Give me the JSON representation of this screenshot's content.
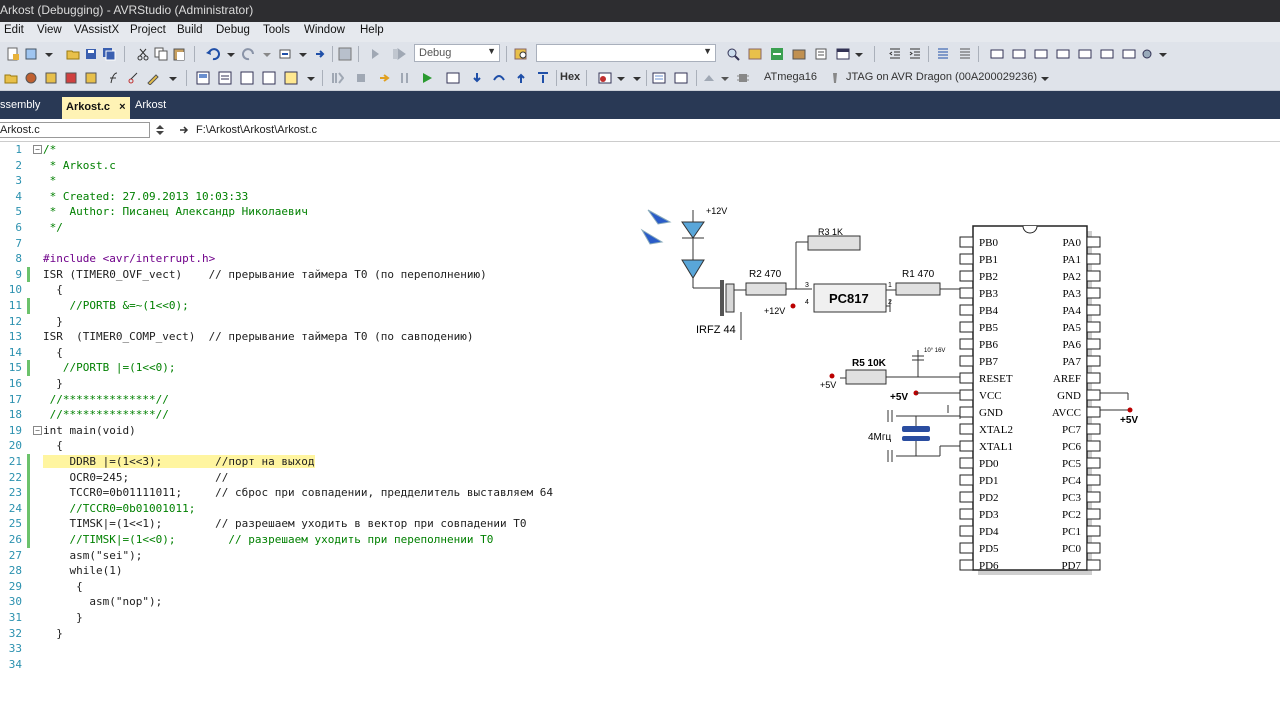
{
  "window": {
    "title": "Arkost (Debugging) - AVRStudio (Administrator)"
  },
  "menu": [
    "Edit",
    "View",
    "VAssistX",
    "Project",
    "Build",
    "Debug",
    "Tools",
    "Window",
    "Help"
  ],
  "toolbar": {
    "config_value": "Debug",
    "hex_label": "Hex",
    "device": "ATmega16",
    "tool": "JTAG on AVR Dragon (00A200029236)"
  },
  "tabs": [
    {
      "label": "ssembly"
    },
    {
      "label": "Arkost.c",
      "close": "×"
    },
    {
      "label": "Arkost"
    }
  ],
  "nav": {
    "file": "Arkost.c",
    "path": "F:\\Arkost\\Arkost\\Arkost.c"
  },
  "code_lines": [
    {
      "n": "1",
      "text": "/*"
    },
    {
      "n": "2",
      "text": " * Arkost.c"
    },
    {
      "n": "3",
      "text": " *"
    },
    {
      "n": "4",
      "text": " * Created: 27.09.2013 10:03:33"
    },
    {
      "n": "5",
      "text": " *  Author: Писанец Александр Николаевич"
    },
    {
      "n": "6",
      "text": " */"
    },
    {
      "n": "7",
      "text": ""
    },
    {
      "n": "8",
      "text": "#include <avr/interrupt.h>"
    },
    {
      "n": "9",
      "text": "ISR (TIMER0_OVF_vect)    // прерывание таймера T0 (по переполнению)"
    },
    {
      "n": "10",
      "text": "  {"
    },
    {
      "n": "11",
      "text": "    //PORTB &=~(1<<0);"
    },
    {
      "n": "12",
      "text": "  }"
    },
    {
      "n": "13",
      "text": "ISR  (TIMER0_COMP_vect)  // прерывание таймера T0 (по савподению)"
    },
    {
      "n": "14",
      "text": "  {"
    },
    {
      "n": "15",
      "text": "   //PORTB |=(1<<0);"
    },
    {
      "n": "16",
      "text": "  }"
    },
    {
      "n": "17",
      "text": " //**************//"
    },
    {
      "n": "18",
      "text": " //**************//"
    },
    {
      "n": "19",
      "text": "int main(void)"
    },
    {
      "n": "20",
      "text": "  {"
    },
    {
      "n": "21",
      "text": "    DDRB |=(1<<3);        //порт на выход"
    },
    {
      "n": "22",
      "text": "    OCR0=245;             //"
    },
    {
      "n": "23",
      "text": "    TCCR0=0b01111011;     // сброс при совпадении, предделитель выставляем 64"
    },
    {
      "n": "24",
      "text": "    //TCCR0=0b01001011;"
    },
    {
      "n": "25",
      "text": "    TIMSK|=(1<<1);        // разрешаем уходить в вектор при совпадении T0"
    },
    {
      "n": "26",
      "text": "    //TIMSK|=(1<<0);        // разрешаем уходить при переполнении T0"
    },
    {
      "n": "27",
      "text": "    asm(\"sei\");"
    },
    {
      "n": "28",
      "text": "    while(1)"
    },
    {
      "n": "29",
      "text": "     {"
    },
    {
      "n": "30",
      "text": "       asm(\"nop\");"
    },
    {
      "n": "31",
      "text": "     }"
    },
    {
      "n": "32",
      "text": "  }"
    },
    {
      "n": "33",
      "text": ""
    },
    {
      "n": "34",
      "text": ""
    }
  ],
  "schematic": {
    "labels": {
      "v12_top": "+12V",
      "r3": "R3 1K",
      "r2": "R2 470",
      "r1": "R1 470",
      "pc817": "PC817",
      "v12_mid": "+12V",
      "irfz": "IRFZ 44",
      "pin3": "3",
      "pin4": "4",
      "pin1": "1",
      "pin2": "2",
      "r5": "R5 10K",
      "v5_left": "+5V",
      "v5_vcc": "+5V",
      "cap": "10° 16V",
      "xtal": "4Мгц",
      "v5_right": "+5V"
    },
    "left_pins": [
      "PB0",
      "PB1",
      "PB2",
      "PB3",
      "PB4",
      "PB5",
      "PB6",
      "PB7",
      "RESET",
      "VCC",
      "GND",
      "XTAL2",
      "XTAL1",
      "PD0",
      "PD1",
      "PD2",
      "PD3",
      "PD4",
      "PD5",
      "PD6"
    ],
    "right_pins": [
      "PA0",
      "PA1",
      "PA2",
      "PA3",
      "PA4",
      "PA5",
      "PA6",
      "PA7",
      "AREF",
      "GND",
      "AVCC",
      "PC7",
      "PC6",
      "PC5",
      "PC4",
      "PC3",
      "PC2",
      "PC1",
      "PC0",
      "PD7"
    ]
  }
}
